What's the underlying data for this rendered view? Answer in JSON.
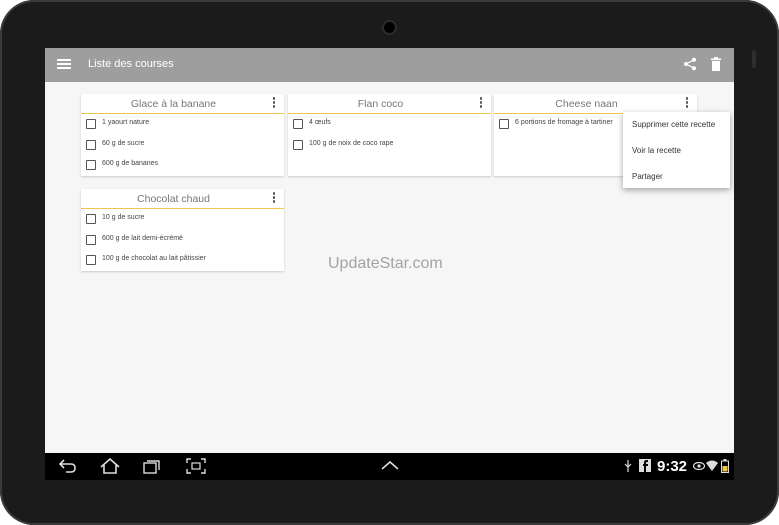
{
  "app": {
    "title": "Liste des courses",
    "bar_color": "#9e9e9e",
    "accent": "#f0c64e"
  },
  "toolbar": {
    "menu_icon": "menu-icon",
    "share_icon": "share-icon",
    "delete_icon": "trash-icon"
  },
  "recipes": [
    {
      "name": "Glace à la banane",
      "items": [
        "1 yaourt nature",
        "60 g de sucre",
        "600 g de bananes"
      ]
    },
    {
      "name": "Flan coco",
      "items": [
        "4 œufs",
        "100 g de noix de coco rape"
      ]
    },
    {
      "name": "Cheese naan",
      "items": [
        "6 portions de fromage à tartiner"
      ]
    },
    {
      "name": "Chocolat chaud",
      "items": [
        "10 g de sucre",
        "600 g de lait demi-écrémé",
        "100 g de chocolat au lait pâtissier"
      ]
    }
  ],
  "context_menu": {
    "items": [
      "Supprimer cette recette",
      "Voir la recette",
      "Partager"
    ]
  },
  "watermark": "UpdateStar.com",
  "status_bar": {
    "time": "9:32"
  }
}
